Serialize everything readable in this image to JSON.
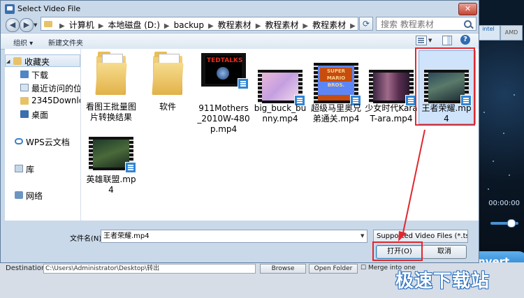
{
  "dialog": {
    "title": "Select Video File",
    "close_label": "✕"
  },
  "address": {
    "breadcrumbs": [
      "计算机",
      "本地磁盘 (D:)",
      "backup",
      "教程素材",
      "教程素材",
      "教程素材"
    ],
    "search_placeholder": "搜索 教程素材"
  },
  "toolbar": {
    "organize_label": "组织 ▾",
    "new_folder_label": "新建文件夹",
    "help_label": "?"
  },
  "nav": {
    "favorites_label": "收藏夹",
    "items": [
      "下载",
      "最近访问的位",
      "2345Downlo",
      "桌面"
    ],
    "wps_label": "WPS云文档",
    "library_label": "库",
    "network_label": "网络"
  },
  "files": [
    {
      "name": "看图王批量图片转换结果",
      "kind": "folder"
    },
    {
      "name": "软件",
      "kind": "folder"
    },
    {
      "name": "911Mothers_2010W-480p.mp4",
      "kind": "video",
      "thumb_text": "TEDTALKS"
    },
    {
      "name": "big_buck_bunny.mp4",
      "kind": "video"
    },
    {
      "name": "超级马里奥兄弟通关.mp4",
      "kind": "video",
      "thumb_text": "SUPER MARIO BROS."
    },
    {
      "name": "少女时代KaraT-ara.mp4",
      "kind": "video"
    },
    {
      "name": "王者荣耀.mp4",
      "kind": "video",
      "selected": true
    },
    {
      "name": "英雄联盟.mp4",
      "kind": "video"
    }
  ],
  "footer": {
    "filename_label": "文件名(N):",
    "filename_value": "王者荣耀.mp4",
    "filetype_value": "Supported Video Files (*.ts;*",
    "open_label": "打开(O)",
    "cancel_label": "取消"
  },
  "background_app": {
    "intel_label": "intel",
    "amd_label": "AMD",
    "time_label": "00:00:00",
    "convert_label": "nvert",
    "destination_label": "Destination:",
    "destination_value": "C:\\Users\\Administrator\\Desktop\\转出",
    "browse_label": "Browse",
    "open_folder_label": "Open Folder",
    "merge_label": "Merge into one"
  },
  "watermark": "极速下载站",
  "colors": {
    "highlight": "#e0282e",
    "selection": "#cfe4fb"
  }
}
